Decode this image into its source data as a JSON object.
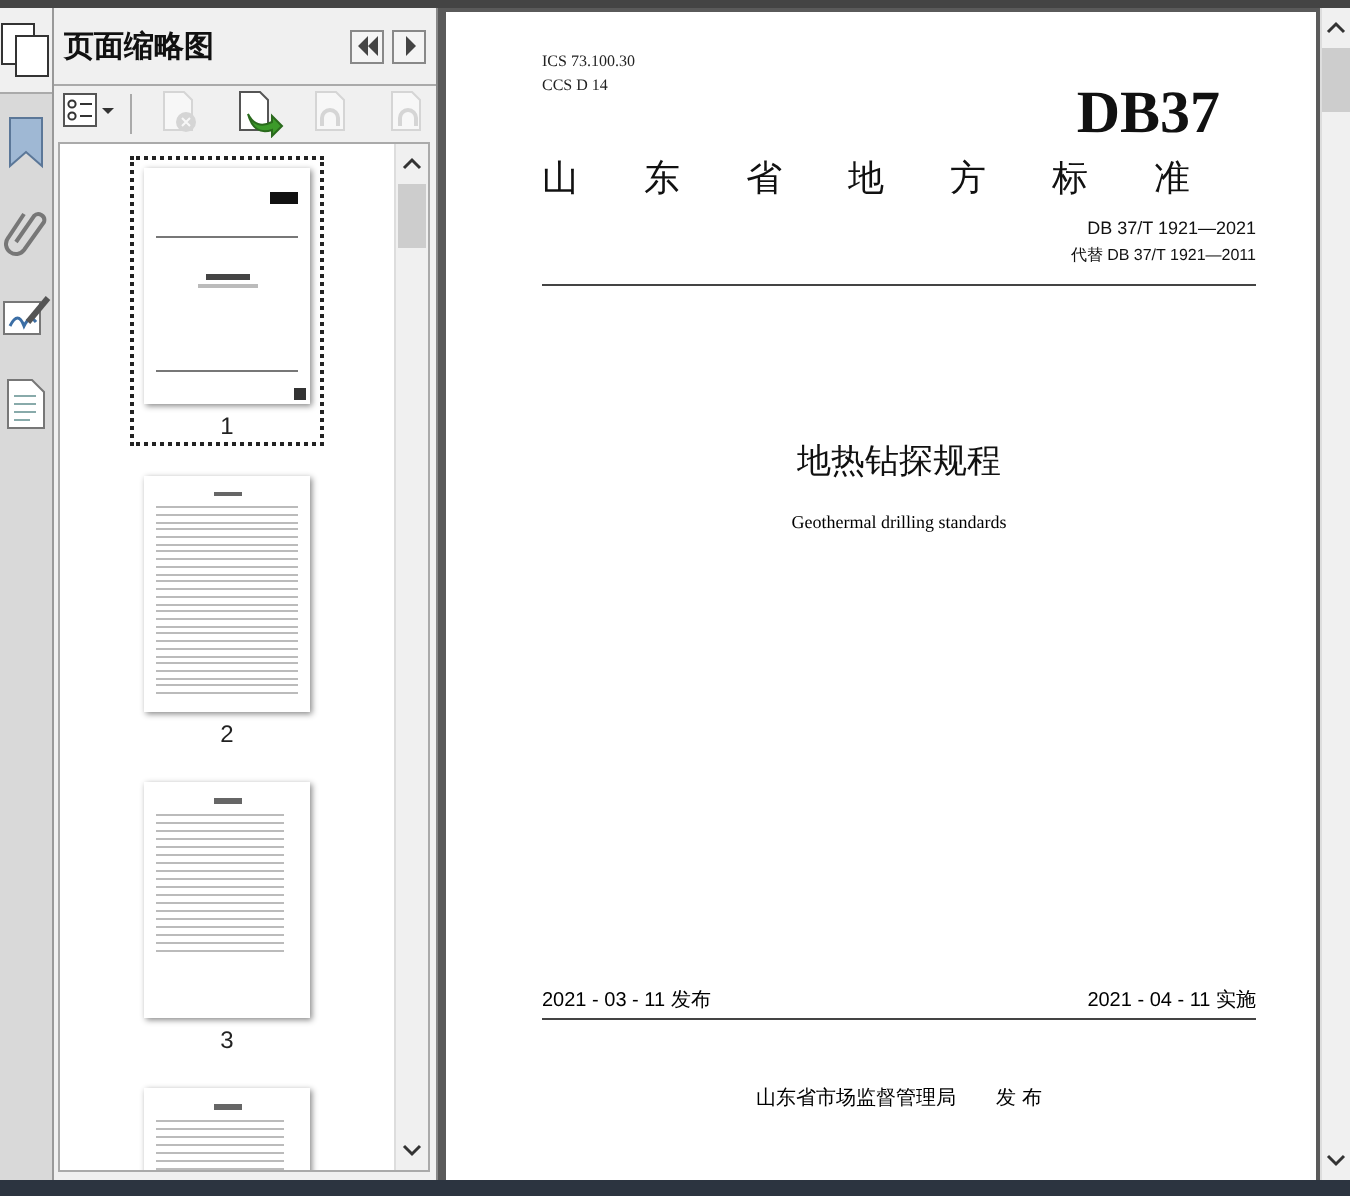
{
  "panel": {
    "title": "页面缩略图"
  },
  "thumbnail_tools": [
    {
      "kind": "options",
      "disabled": false
    },
    {
      "kind": "delete",
      "disabled": true
    },
    {
      "kind": "insert",
      "disabled": false
    },
    {
      "kind": "undo",
      "disabled": true
    },
    {
      "kind": "redo",
      "disabled": true
    }
  ],
  "thumbnails": [
    {
      "label": "1",
      "selected": true,
      "kind": "cover"
    },
    {
      "label": "2",
      "selected": false,
      "kind": "contents"
    },
    {
      "label": "3",
      "selected": false,
      "kind": "text"
    },
    {
      "selected": false,
      "kind": "text"
    }
  ],
  "document": {
    "ics": "ICS  73.100.30",
    "ccs": "CCS  D 14",
    "logo": "DB37",
    "heading": "山东省地方标准",
    "number": "DB 37/T  1921—2021",
    "replaces": "代替 DB 37/T  1921—2011",
    "title": "地热钻探规程",
    "subtitle": "Geothermal drilling standards",
    "issued": "2021 - 03 - 11 发布",
    "effective": "2021 - 04 - 11 实施",
    "publisher": "山东省市场监督管理局",
    "publish_word": "发 布"
  }
}
